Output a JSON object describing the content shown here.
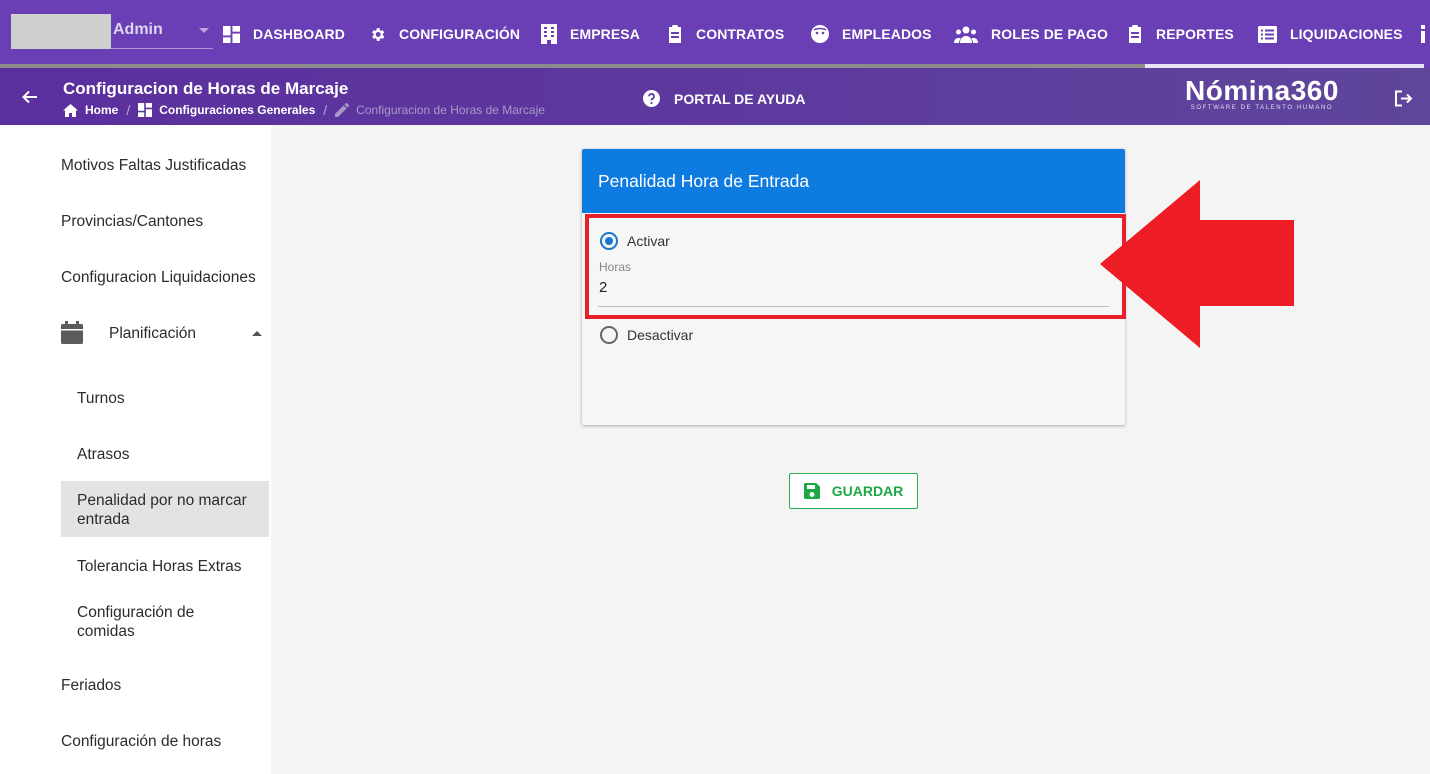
{
  "user": {
    "name": "Admin"
  },
  "nav": {
    "items": [
      {
        "label": "DASHBOARD",
        "icon": "dashboard-icon"
      },
      {
        "label": "CONFIGURACIÓN",
        "icon": "gear-icon"
      },
      {
        "label": "EMPRESA",
        "icon": "building-icon"
      },
      {
        "label": "CONTRATOS",
        "icon": "clipboard-icon"
      },
      {
        "label": "EMPLEADOS",
        "icon": "face-icon"
      },
      {
        "label": "ROLES DE PAGO",
        "icon": "people-icon"
      },
      {
        "label": "REPORTES",
        "icon": "clipboard-icon"
      },
      {
        "label": "LIQUIDACIONES",
        "icon": "list-icon"
      }
    ]
  },
  "subheader": {
    "title": "Configuracion de Horas de Marcaje",
    "breadcrumb": {
      "home": "Home",
      "section": "Configuraciones Generales",
      "current": "Configuracion de Horas de Marcaje"
    },
    "help": "PORTAL DE AYUDA",
    "brand": {
      "name": "Nómina360",
      "tagline": "SOFTWARE DE TALENTO HUMANO"
    }
  },
  "sidebar": {
    "items": [
      "Motivos Faltas Justificadas",
      "Provincias/Cantones",
      "Configuracion Liquidaciones",
      "Planificación",
      "Feriados",
      "Configuración de horas"
    ],
    "sub_items": [
      "Turnos",
      "Atrasos",
      "Penalidad por no marcar entrada",
      "Tolerancia Horas Extras",
      "Configuración de comidas"
    ],
    "active": "Penalidad por no marcar entrada"
  },
  "card": {
    "title": "Penalidad Hora de Entrada",
    "option_on": "Activar",
    "option_off": "Desactivar",
    "selected": "Activar",
    "field_label": "Horas",
    "field_value": "2"
  },
  "actions": {
    "save_label": "GUARDAR"
  },
  "colors": {
    "nav_bg": "#6a3fb5",
    "card_header": "#0e7be0",
    "highlight": "#e8202a",
    "save_green": "#1ea745"
  }
}
